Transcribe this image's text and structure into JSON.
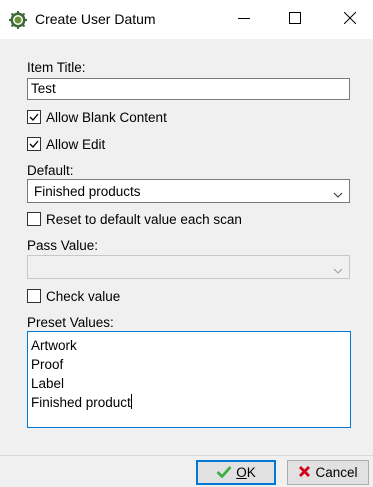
{
  "window": {
    "title": "Create User Datum",
    "icon": "gear-sun-icon",
    "controls": [
      "minimize-icon",
      "maximize-icon",
      "close-icon"
    ]
  },
  "form": {
    "item_title_label": "Item Title:",
    "item_title_value": "Test",
    "allow_blank": {
      "label": "Allow Blank Content",
      "checked": true
    },
    "allow_edit": {
      "label": "Allow Edit",
      "checked": true
    },
    "default_label": "Default:",
    "default_value": "Finished products",
    "reset_default": {
      "label": "Reset to default value each scan",
      "checked": false
    },
    "pass_value_label": "Pass Value:",
    "pass_value": "",
    "check_value": {
      "label": "Check value",
      "checked": false
    },
    "preset_values_label": "Preset Values:",
    "preset_values": [
      "Artwork",
      "Proof",
      "Label",
      "Finished product"
    ]
  },
  "buttons": {
    "ok_label": "OK",
    "ok_mnemonic": "O",
    "ok_rest": "K",
    "cancel_label": "Cancel"
  },
  "colors": {
    "focus": "#0078d7",
    "ok_check": "#3cb043",
    "cancel_x": "#d0021b"
  }
}
